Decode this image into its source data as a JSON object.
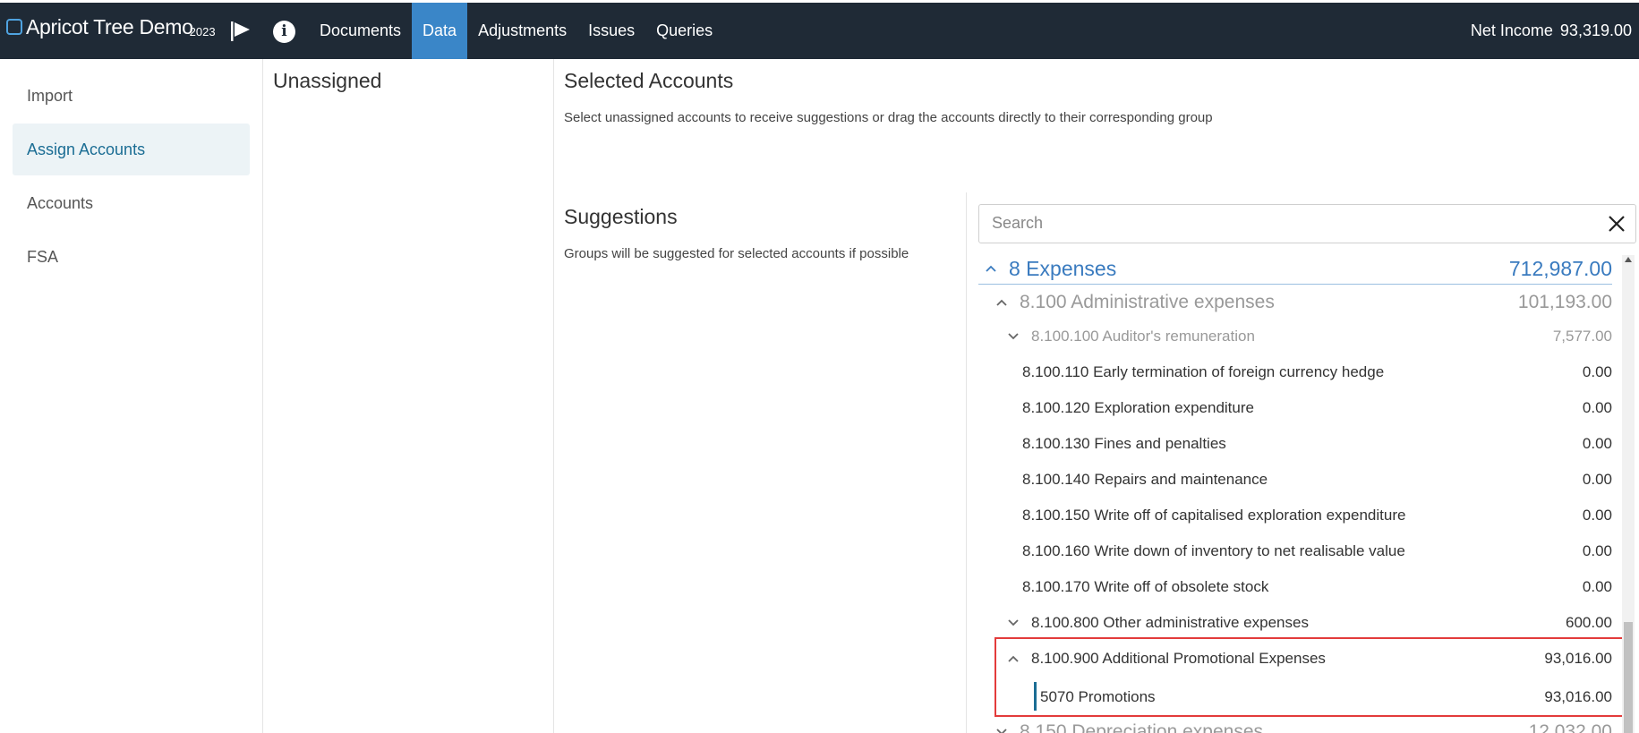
{
  "app": {
    "name": "Apricot Tree Demo",
    "year": "2023",
    "icons": [
      "checkbox-logo-icon",
      "flag-icon",
      "info-icon"
    ]
  },
  "nav": {
    "items": [
      {
        "label": "Documents",
        "active": false
      },
      {
        "label": "Data",
        "active": true
      },
      {
        "label": "Adjustments",
        "active": false
      },
      {
        "label": "Issues",
        "active": false
      },
      {
        "label": "Queries",
        "active": false
      }
    ],
    "net_income_label": "Net Income",
    "net_income_value": "93,319.00"
  },
  "sidebar": {
    "items": [
      {
        "label": "Import",
        "active": false
      },
      {
        "label": "Assign Accounts",
        "active": true
      },
      {
        "label": "Accounts",
        "active": false
      },
      {
        "label": "FSA",
        "active": false
      }
    ]
  },
  "unassigned": {
    "title": "Unassigned"
  },
  "selected": {
    "title": "Selected Accounts",
    "description": "Select unassigned accounts to receive suggestions or drag the accounts directly to their corresponding group"
  },
  "suggestions": {
    "title": "Suggestions",
    "description": "Groups will be suggested for selected accounts if possible"
  },
  "search": {
    "placeholder": "Search"
  },
  "tree": [
    {
      "label": "8 Expenses",
      "amount": "712,987.00",
      "level": 0,
      "chevron": "up"
    },
    {
      "label": "8.100 Administrative expenses",
      "amount": "101,193.00",
      "level": 1,
      "chevron": "up"
    },
    {
      "label": "8.100.100 Auditor's remuneration",
      "amount": "7,577.00",
      "level": 2,
      "chevron": "down"
    },
    {
      "label": "8.100.110 Early termination of foreign currency hedge",
      "amount": "0.00",
      "level": 3
    },
    {
      "label": "8.100.120 Exploration expenditure",
      "amount": "0.00",
      "level": 3
    },
    {
      "label": "8.100.130 Fines and penalties",
      "amount": "0.00",
      "level": 3
    },
    {
      "label": "8.100.140 Repairs and maintenance",
      "amount": "0.00",
      "level": 3
    },
    {
      "label": "8.100.150 Write off of capitalised exploration expenditure",
      "amount": "0.00",
      "level": 3
    },
    {
      "label": "8.100.160 Write down of inventory to net realisable value",
      "amount": "0.00",
      "level": 3
    },
    {
      "label": "8.100.170 Write off of obsolete stock",
      "amount": "0.00",
      "level": 3
    },
    {
      "label": "8.100.800 Other administrative expenses",
      "amount": "600.00",
      "level": 2,
      "chevron": "down"
    },
    {
      "label": "8.100.900 Additional Promotional Expenses",
      "amount": "93,016.00",
      "level": 2,
      "chevron": "up",
      "highlighted": true
    },
    {
      "label": "5070 Promotions",
      "amount": "93,016.00",
      "level": 4,
      "highlighted": true
    },
    {
      "label": "8.150 Depreciation expenses",
      "amount": "12,032.00",
      "level": 1,
      "chevron": "down"
    }
  ],
  "colors": {
    "topbar": "#1f2a36",
    "active_nav": "#3a86c8",
    "accent": "#1b6d94",
    "highlight_border": "#e33b3b",
    "tree_root": "#3a7bbf"
  }
}
